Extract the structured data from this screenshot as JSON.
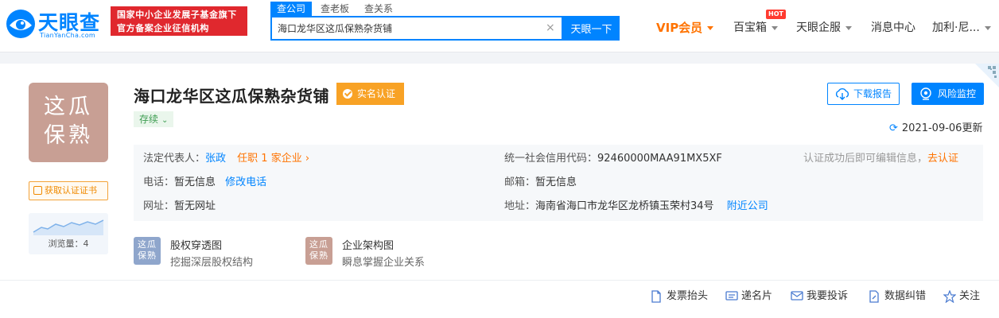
{
  "header": {
    "logo_text": "天眼查",
    "logo_sub": "TianYanCha.com",
    "gov_line1": "国家中小企业发展子基金旗下",
    "gov_line2": "官方备案企业征信机构",
    "search_tabs": [
      "查公司",
      "查老板",
      "查关系"
    ],
    "search_value": "海口龙华区这瓜保熟杂货铺",
    "search_clear": "×",
    "search_button": "天眼一下",
    "nav": {
      "vip": "VIP会员",
      "treasure": "百宝箱",
      "hot_badge": "HOT",
      "enterprise": "天眼企服",
      "messages": "消息中心",
      "user": "加利·尼..."
    }
  },
  "company": {
    "avatar_line1": "这瓜",
    "avatar_line2": "保熟",
    "name": "海口龙华区这瓜保熟杂货铺",
    "verify_badge": "实名认证",
    "status": "存续",
    "download_btn": "下载报告",
    "monitor_btn": "风险监控",
    "updated": "2021-09-06更新",
    "cert_btn": "获取认证证书",
    "views_label": "浏览量：4"
  },
  "info": {
    "legal_rep_label": "法定代表人：",
    "legal_rep_name": "张政",
    "legal_rep_link": "任职 1 家企业",
    "credit_label": "统一社会信用代码：",
    "credit_code": "92460000MAA91MX5XF",
    "auth_tip": "认证成功后即可编辑信息，",
    "auth_link": "去认证",
    "phone_label": "电话：",
    "phone_value": "暂无信息",
    "phone_edit": "修改电话",
    "email_label": "邮箱：",
    "email_value": "暂无信息",
    "website_label": "网址：",
    "website_value": "暂无网址",
    "address_label": "地址：",
    "address_value": "海南省海口市龙华区龙桥镇玉荣村34号",
    "nearby_link": "附近公司"
  },
  "tools": [
    {
      "icon_line1": "这瓜",
      "icon_line2": "保熟",
      "title": "股权穿透图",
      "desc": "挖掘深层股权结构",
      "color": "#8fa6cc"
    },
    {
      "icon_line1": "这瓜",
      "icon_line2": "保熟",
      "title": "企业架构图",
      "desc": "瞬息掌握企业关系",
      "color": "#c89f94"
    }
  ],
  "bottom_actions": [
    "发票抬头",
    "递名片",
    "我要投诉",
    "数据纠错",
    "关注"
  ],
  "colors": {
    "brand": "#0084ff",
    "gov_red": "#e0282e",
    "vip_orange": "#ff7300",
    "verify_orange": "#f8a225",
    "status_green": "#3e9d52",
    "avatar": "#c89f94"
  }
}
